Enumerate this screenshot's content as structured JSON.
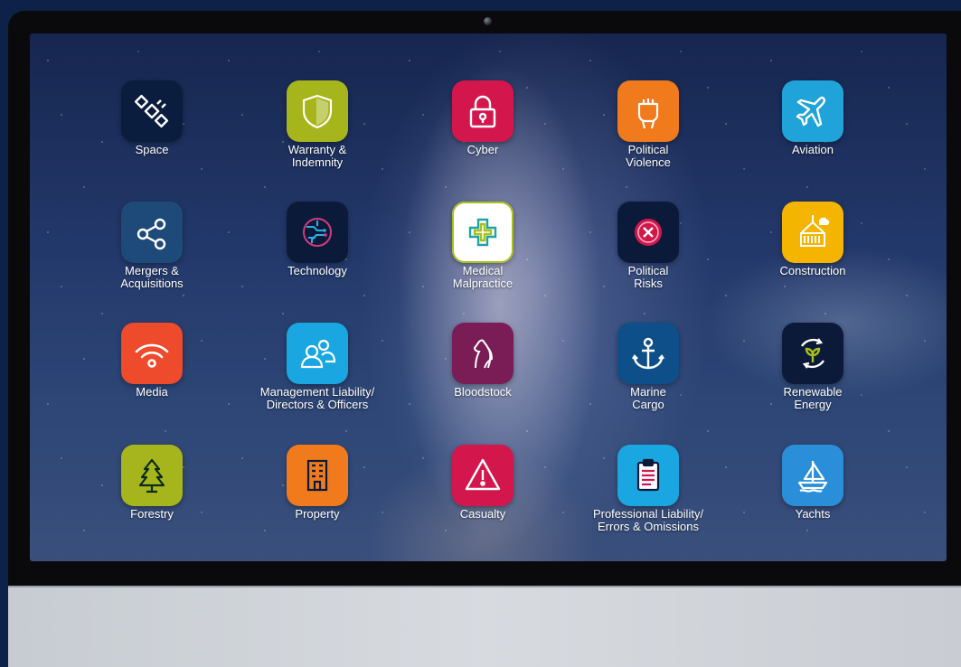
{
  "apps": [
    {
      "label": "Space",
      "icon": "satellite-icon",
      "color": "#0b1d3f"
    },
    {
      "label": "Warranty &\nIndemnity",
      "icon": "shield-icon",
      "color": "#a7b51c"
    },
    {
      "label": "Cyber",
      "icon": "padlock-icon",
      "color": "#d3174c"
    },
    {
      "label": "Political\nViolence",
      "icon": "raised-fist-icon",
      "color": "#f07a1c"
    },
    {
      "label": "Aviation",
      "icon": "airplane-icon",
      "color": "#1fa3d8"
    },
    {
      "label": "Mergers &\nAcquisitions",
      "icon": "share-nodes-icon",
      "color": "#1e4a7a"
    },
    {
      "label": "Technology",
      "icon": "circuit-globe-icon",
      "color": "#0c1a3a"
    },
    {
      "label": "Medical\nMalpractice",
      "icon": "medical-cross-icon",
      "color": "#ffffff"
    },
    {
      "label": "Political\nRisks",
      "icon": "x-circle-icon",
      "color": "#0c1a3a"
    },
    {
      "label": "Construction",
      "icon": "crane-container-icon",
      "color": "#f5b400"
    },
    {
      "label": "Media",
      "icon": "wifi-signal-icon",
      "color": "#ee4a2c"
    },
    {
      "label": "Management Liability/\nDirectors & Officers",
      "icon": "people-icon",
      "color": "#1aa6e0"
    },
    {
      "label": "Bloodstock",
      "icon": "horse-head-icon",
      "color": "#7a1d56"
    },
    {
      "label": "Marine\nCargo",
      "icon": "anchor-icon",
      "color": "#0e4f8a"
    },
    {
      "label": "Renewable\nEnergy",
      "icon": "renewable-leaf-icon",
      "color": "#0c1a3a"
    },
    {
      "label": "Forestry",
      "icon": "tree-icon",
      "color": "#a7b51c"
    },
    {
      "label": "Property",
      "icon": "building-icon",
      "color": "#f07a1c"
    },
    {
      "label": "Casualty",
      "icon": "warning-triangle-icon",
      "color": "#d3174c"
    },
    {
      "label": "Professional Liability/\nErrors & Omissions",
      "icon": "clipboard-icon",
      "color": "#1aa6e0"
    },
    {
      "label": "Yachts",
      "icon": "sailboat-icon",
      "color": "#2a8fd8"
    }
  ]
}
